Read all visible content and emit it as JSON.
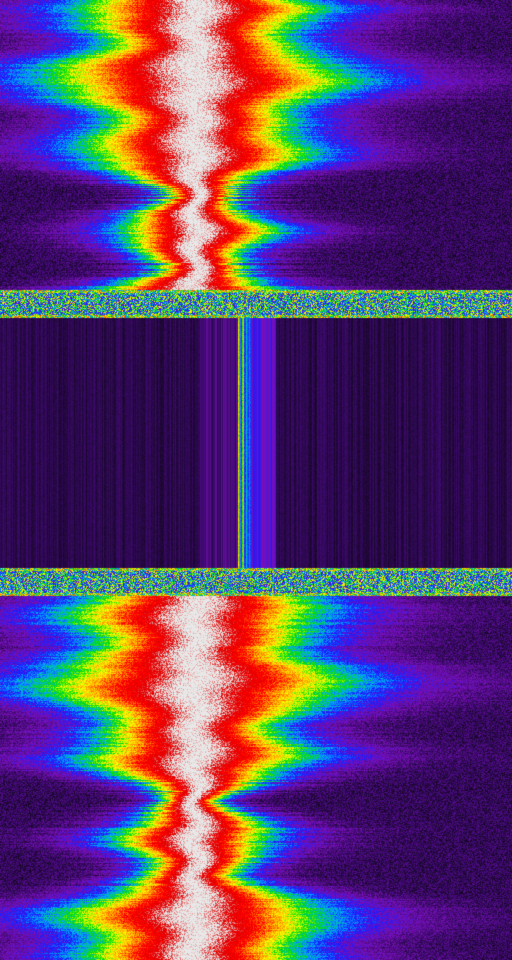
{
  "waterfall": {
    "colormap": [
      "#0a0510",
      "#3d0a6e",
      "#7a10b8",
      "#1a1aff",
      "#00a8ff",
      "#00e000",
      "#ffff00",
      "#ff9000",
      "#ff0000",
      "#e00000",
      "#e8e8e8"
    ],
    "background": "#000000",
    "segments": [
      {
        "kind": "signal",
        "rows": 290
      },
      {
        "kind": "noise-band",
        "rows": 28
      },
      {
        "kind": "quiet",
        "rows": 250
      },
      {
        "kind": "noise-band",
        "rows": 28
      },
      {
        "kind": "signal",
        "rows": 364
      }
    ]
  }
}
